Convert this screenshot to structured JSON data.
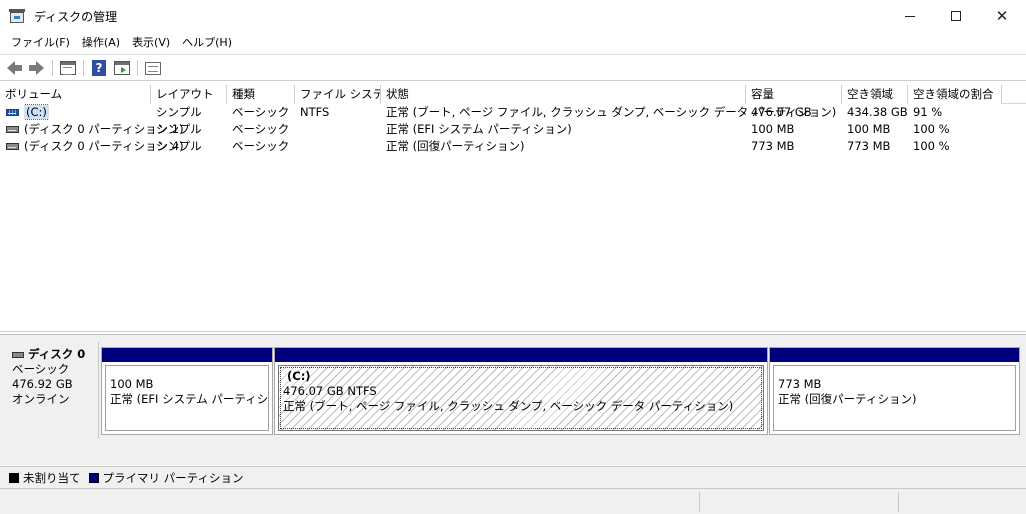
{
  "window": {
    "title": "ディスクの管理",
    "close_glyph": "✕"
  },
  "menu": [
    {
      "label": "ファイル(F)"
    },
    {
      "label": "操作(A)"
    },
    {
      "label": "表示(V)"
    },
    {
      "label": "ヘルプ(H)"
    }
  ],
  "toolbar": {
    "buttons": [
      "back-arrow-icon",
      "forward-arrow-icon",
      "list-view-icon",
      "help-icon",
      "action-pane-icon",
      "properties-icon"
    ],
    "help_glyph": "?"
  },
  "volume_list": {
    "columns": [
      "ボリューム",
      "レイアウト",
      "種類",
      "ファイル システム",
      "状態",
      "容量",
      "空き領域",
      "空き領域の割合"
    ],
    "rows": [
      {
        "volume": "(C:)",
        "layout": "シンプル",
        "type": "ベーシック",
        "fs": "NTFS",
        "status": "正常 (ブート, ページ ファイル, クラッシュ ダンプ, ベーシック データ パーティション)",
        "capacity": "476.07 GB",
        "free": "434.38 GB",
        "percent": "91 %"
      },
      {
        "volume": "(ディスク 0 パーティション 1)",
        "layout": "シンプル",
        "type": "ベーシック",
        "fs": "",
        "status": "正常 (EFI システム パーティション)",
        "capacity": "100 MB",
        "free": "100 MB",
        "percent": "100 %"
      },
      {
        "volume": "(ディスク 0 パーティション 4)",
        "layout": "シンプル",
        "type": "ベーシック",
        "fs": "",
        "status": "正常 (回復パーティション)",
        "capacity": "773 MB",
        "free": "773 MB",
        "percent": "100 %"
      }
    ]
  },
  "disk": {
    "name": "ディスク 0",
    "type": "ベーシック",
    "size": "476.92 GB",
    "state": "オンライン",
    "partitions": [
      {
        "title": "",
        "size": "100 MB",
        "status": "正常 (EFI システム パーティション)"
      },
      {
        "title": "(C:)",
        "size": "476.07 GB NTFS",
        "status": "正常 (ブート, ページ ファイル, クラッシュ ダンプ, ベーシック データ パーティション)"
      },
      {
        "title": "",
        "size": "773 MB",
        "status": "正常 (回復パーティション)"
      }
    ]
  },
  "legend": [
    {
      "label": "未割り当て",
      "color": "#000000"
    },
    {
      "label": "プライマリ パーティション",
      "color": "#00007f"
    }
  ],
  "colors": {
    "partition_bar": "#00007f",
    "selection": "#cde2f7"
  }
}
